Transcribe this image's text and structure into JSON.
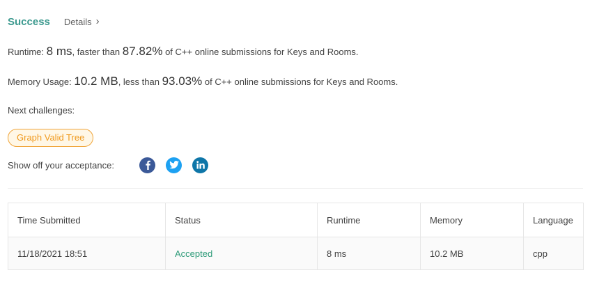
{
  "header": {
    "status": "Success",
    "details_label": "Details",
    "chevron": "›"
  },
  "runtime": {
    "label": "Runtime:",
    "value": "8 ms",
    "comparison": ", faster than",
    "percent": "87.82%",
    "suffix": "of C++ online submissions for Keys and Rooms."
  },
  "memory": {
    "label": "Memory Usage:",
    "value": "10.2 MB",
    "comparison": ", less than",
    "percent": "93.03%",
    "suffix": "of C++ online submissions for Keys and Rooms."
  },
  "next": {
    "label": "Next challenges:",
    "challenges": [
      "Graph Valid Tree"
    ]
  },
  "share": {
    "label": "Show off your acceptance:",
    "icons": [
      "facebook-icon",
      "twitter-icon",
      "linkedin-icon"
    ],
    "colors": {
      "facebook": "#3b5998",
      "twitter": "#1da1f2",
      "linkedin": "#0e76a8"
    }
  },
  "table": {
    "headers": [
      "Time Submitted",
      "Status",
      "Runtime",
      "Memory",
      "Language"
    ],
    "rows": [
      [
        "11/18/2021 18:51",
        "Accepted",
        "8 ms",
        "10.2 MB",
        "cpp"
      ]
    ]
  },
  "colors": {
    "success": "#3d9a8f",
    "accepted": "#2e9b79",
    "challenge": "#f09a1e"
  }
}
